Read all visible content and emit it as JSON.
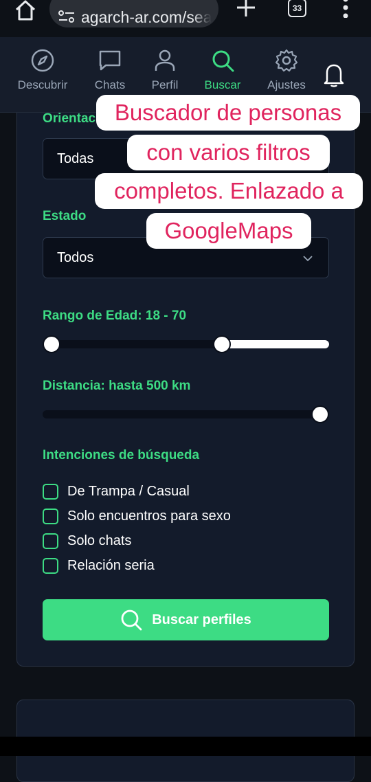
{
  "browser": {
    "url": "agarch-ar.com/sea",
    "tab_count": "33"
  },
  "nav": {
    "items": [
      {
        "label": "Descubrir",
        "icon": "compass-icon"
      },
      {
        "label": "Chats",
        "icon": "chat-icon"
      },
      {
        "label": "Perfil",
        "icon": "user-icon"
      },
      {
        "label": "Buscar",
        "icon": "search-icon",
        "active": true
      },
      {
        "label": "Ajustes",
        "icon": "gear-icon"
      }
    ],
    "bell_icon": "bell-icon"
  },
  "form": {
    "orientation_label": "Orientación",
    "orientation_value": "Todas",
    "state_label": "Estado",
    "state_value": "Todos",
    "age_label": "Rango de Edad: 18 - 70",
    "age_range": {
      "min": 18,
      "max": 70,
      "slider_min": 18,
      "slider_max": 100
    },
    "distance_label": "Distancia: hasta 500 km",
    "distance": {
      "value": 500,
      "max": 500
    },
    "intentions_label": "Intenciones de búsqueda",
    "intentions": [
      {
        "label": "De Trampa / Casual",
        "checked": false
      },
      {
        "label": "Solo encuentros para sexo",
        "checked": false
      },
      {
        "label": "Solo chats",
        "checked": false
      },
      {
        "label": "Relación seria",
        "checked": false
      }
    ],
    "submit_label": "Buscar perfiles"
  },
  "overlay": {
    "lines": [
      "Buscador de personas",
      "con varios filtros",
      "completos. Enlazado a",
      "GoogleMaps"
    ]
  },
  "colors": {
    "accent": "#3ddc84",
    "background": "#0d1117",
    "card": "#131b2b",
    "overlay_text": "#e0245e"
  }
}
